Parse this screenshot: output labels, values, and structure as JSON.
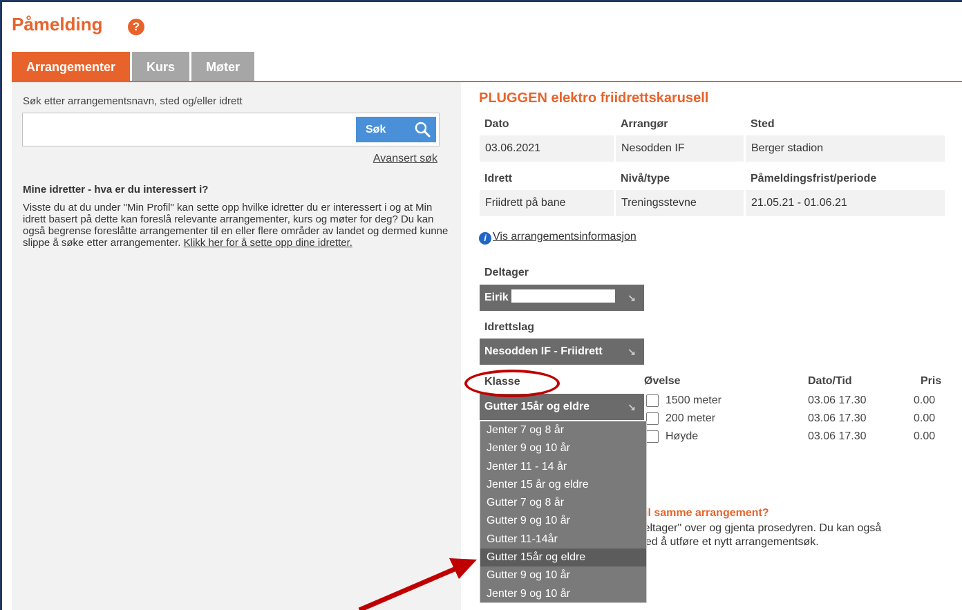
{
  "page": {
    "title": "Påmelding",
    "help_glyph": "?"
  },
  "tabs": [
    {
      "label": "Arrangementer",
      "active": true
    },
    {
      "label": "Kurs",
      "active": false
    },
    {
      "label": "Møter",
      "active": false
    }
  ],
  "search": {
    "label": "Søk etter arrangementsnavn, sted og/eller idrett",
    "value": "",
    "button_label": "Søk",
    "advanced_label": "Avansert søk"
  },
  "mine": {
    "title": "Mine idretter - hva er du interessert i?",
    "text": "Visste du at du under \"Min Profil\" kan sette opp hvilke idretter du er interessert i og at Min idrett basert på dette kan foreslå relevante arrangementer, kurs og møter for deg? Du kan også begrense foreslåtte arrangementer til en eller flere områder av landet og dermed kunne slippe å søke etter arrangementer. ",
    "link": "Klikk her for å sette opp dine idretter."
  },
  "event": {
    "title": "PLUGGEN elektro friidrettskarusell",
    "headers1": [
      "Dato",
      "Arrangør",
      "Sted"
    ],
    "values1": [
      "03.06.2021",
      "Nesodden IF",
      "Berger stadion"
    ],
    "headers2": [
      "Idrett",
      "Nivå/type",
      "Påmeldingsfrist/periode"
    ],
    "values2": [
      "Friidrett på bane",
      "Treningsstevne",
      "21.05.21 - 01.06.21"
    ],
    "info_link": "Vis arrangementsinformasjon",
    "info_glyph": "i"
  },
  "form": {
    "deltager_label": "Deltager",
    "deltager_value": "Eirik",
    "idrettslag_label": "Idrettslag",
    "idrettslag_value": "Nesodden IF - Friidrett",
    "klasse_label": "Klasse",
    "klasse_value": "Gutter 15år og eldre",
    "arrow_glyph": "↘"
  },
  "exercises": {
    "headers": [
      "Øvelse",
      "Dato/Tid",
      "Pris"
    ],
    "rows": [
      {
        "name": "1500 meter",
        "time": "03.06 17.30",
        "price": "0.00"
      },
      {
        "name": "200 meter",
        "time": "03.06 17.30",
        "price": "0.00"
      },
      {
        "name": "Høyde",
        "time": "03.06 17.30",
        "price": "0.00"
      }
    ]
  },
  "more": {
    "title": "r til samme arrangement?",
    "text_line1": "\"deltager\" over og gjenta prosedyren. Du kan også",
    "text_line2": "t ved å utføre et nytt arrangementsøk."
  },
  "klasse_options": [
    "Jenter 7 og 8 år",
    "Jenter 9 og 10 år",
    "Jenter 11 - 14 år",
    "Jenter 15 år og eldre",
    "Gutter 7 og 8 år",
    "Gutter 9 og 10 år",
    "Gutter 11-14år",
    "Gutter 15år og eldre",
    "Gutter 9 og 10 år",
    "Jenter 9 og 10 år"
  ],
  "selected_option_index": 7,
  "colors": {
    "accent": "#e8632b",
    "annotation": "#c00000",
    "search_button": "#4a90d9"
  }
}
